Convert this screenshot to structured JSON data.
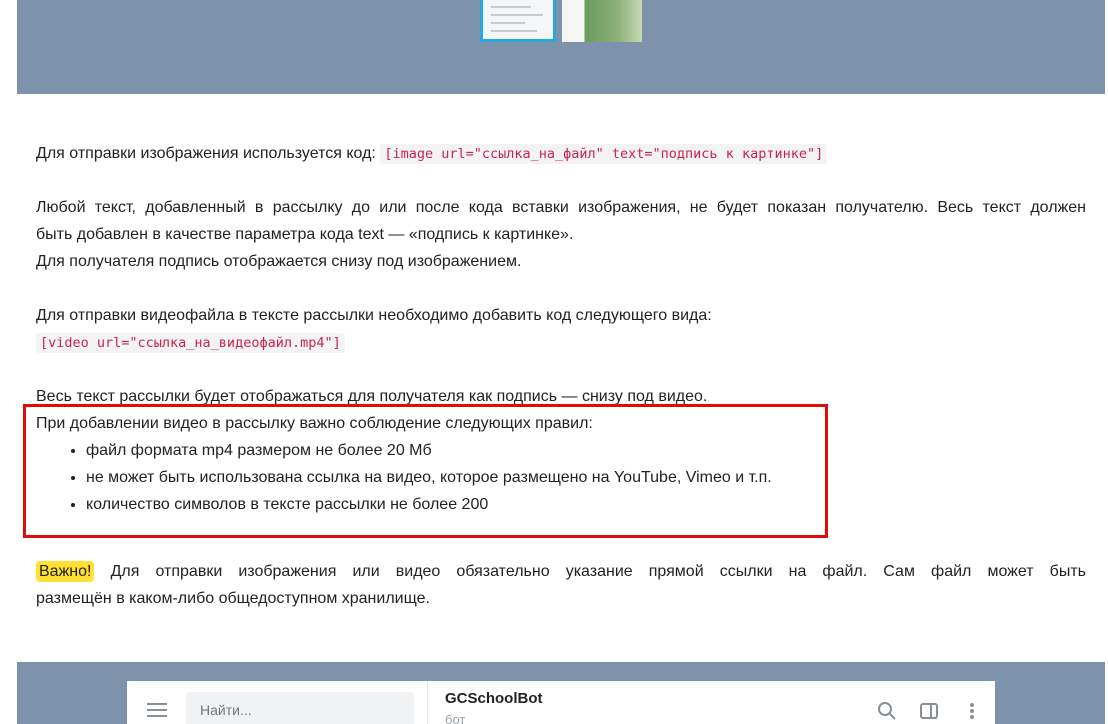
{
  "top_banner": {
    "thumbnails": [
      "chat-thumbnail",
      "photo-thumbnail"
    ]
  },
  "paragraphs": {
    "image_intro": "Для отправки изображения используется код:",
    "image_code": "[image url=\"ссылка_на_файл\" text=\"подпись к картинке\"]",
    "text_note_line1": "Любой текст, добавленный в рассылку до или после кода вставки изображения, не будет показан получателю. Весь текст должен",
    "text_note_line2": "быть добавлен в качестве параметра кода text — «подпись к картинке».",
    "caption_note": "Для получателя подпись отображается снизу под изображением.",
    "video_intro": "Для отправки видеофайла в тексте рассылки необходимо добавить код следующего вида:",
    "video_code": "[video url=\"ссылка_на_видеофайл.mp4\"]",
    "video_caption_note": "Весь текст рассылки будет отображаться для получателя как подпись — снизу под видео."
  },
  "rules": {
    "intro": "При добавлении видео в рассылку важно соблюдение следующих правил:",
    "items": [
      "файл формата mp4 размером не более 20 Мб",
      "не может быть использована ссылка на видео, которое размещено на YouTube, Vimeo и т.п.",
      "количество символов в тексте рассылки не более 200"
    ]
  },
  "important": {
    "badge": "Важно!",
    "text_line1": "Для отправки изображения или видео обязательно указание прямой ссылки на файл. Сам файл может быть",
    "text_line2": "размещён в каком-либо общедоступном  хранилище."
  },
  "telegram_preview": {
    "search_placeholder": "Найти...",
    "bot_name": "GCSchoolBot",
    "bot_status": "бот",
    "icons": [
      "menu-icon",
      "search-icon",
      "side-panel-icon",
      "more-icon"
    ]
  },
  "colors": {
    "banner": "#7d93ab",
    "code_text": "#c7254e",
    "highlight_border": "#e10b0b",
    "badge": "#ffe033"
  }
}
